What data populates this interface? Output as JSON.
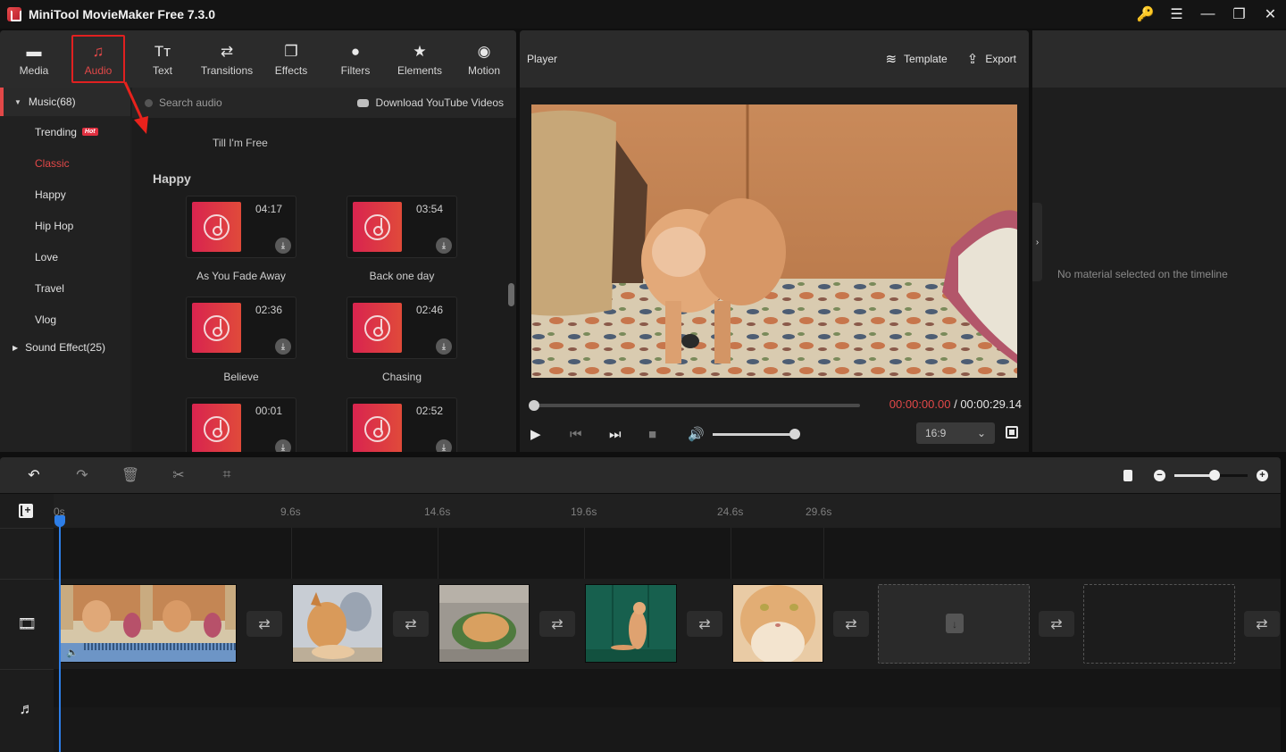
{
  "window": {
    "title": "MiniTool MovieMaker Free 7.3.0",
    "controls": [
      {
        "name": "key-icon",
        "glyph": "🔑"
      },
      {
        "name": "menu-icon",
        "glyph": "☰"
      },
      {
        "name": "minimize-icon",
        "glyph": "—"
      },
      {
        "name": "maximize-icon",
        "glyph": "❐"
      },
      {
        "name": "close-icon",
        "glyph": "✕"
      }
    ]
  },
  "toolbar": {
    "tabs": [
      {
        "label": "Media",
        "icon": "folder-icon",
        "glyph": "▬"
      },
      {
        "label": "Audio",
        "icon": "music-icon",
        "glyph": "♫",
        "active": true
      },
      {
        "label": "Text",
        "icon": "text-icon",
        "glyph": "Tт"
      },
      {
        "label": "Transitions",
        "icon": "transitions-icon",
        "glyph": "⇄"
      },
      {
        "label": "Effects",
        "icon": "effects-icon",
        "glyph": "❐"
      },
      {
        "label": "Filters",
        "icon": "filters-icon",
        "glyph": "●"
      },
      {
        "label": "Elements",
        "icon": "elements-icon",
        "glyph": "★"
      },
      {
        "label": "Motion",
        "icon": "motion-icon",
        "glyph": "◉"
      }
    ]
  },
  "audio_library": {
    "music_group": "Music(68)",
    "categories": [
      {
        "label": "Trending",
        "badge": "Hot"
      },
      {
        "label": "Classic",
        "active": true
      },
      {
        "label": "Happy"
      },
      {
        "label": "Hip Hop"
      },
      {
        "label": "Love"
      },
      {
        "label": "Travel"
      },
      {
        "label": "Vlog"
      }
    ],
    "sound_effect_group": "Sound Effect(25)",
    "search_placeholder": "Search audio",
    "download_youtube": "Download YouTube Videos",
    "previous_item_title": "Till I'm Free",
    "section_title": "Happy",
    "tracks": [
      {
        "title": "As You Fade Away",
        "duration": "04:17"
      },
      {
        "title": "Back one day",
        "duration": "03:54"
      },
      {
        "title": "Believe",
        "duration": "02:36"
      },
      {
        "title": "Chasing",
        "duration": "02:46"
      },
      {
        "title": "",
        "duration": "00:01"
      },
      {
        "title": "",
        "duration": "02:52"
      }
    ]
  },
  "player": {
    "title": "Player",
    "template_label": "Template",
    "export_label": "Export",
    "current_time": "00:00:00.00",
    "separator": " / ",
    "total_time": "00:00:29.14",
    "progress_percent": 0,
    "volume_percent": 100,
    "aspect_ratio": "16:9",
    "controls": {
      "play": "▶",
      "prev_frame": "⏮",
      "next_frame": "⏭",
      "stop": "■",
      "volume": "🔊"
    }
  },
  "properties": {
    "empty_message": "No material selected on the timeline",
    "collapse_glyph": "›"
  },
  "timeline": {
    "tools": [
      {
        "name": "undo",
        "glyph": "↶",
        "enabled": true
      },
      {
        "name": "redo",
        "glyph": "↷",
        "enabled": false
      },
      {
        "name": "delete",
        "glyph": "🗑",
        "enabled": false
      },
      {
        "name": "split",
        "glyph": "✂",
        "enabled": false
      },
      {
        "name": "crop",
        "glyph": "⌗",
        "enabled": false
      }
    ],
    "zoom_percent": 55,
    "ruler_ticks": [
      "0s",
      "9.6s",
      "14.6s",
      "19.6s",
      "24.6s",
      "29.6s"
    ],
    "track_icons": {
      "video": "🎞",
      "music": "♬"
    },
    "clips": [
      {
        "type": "video",
        "subject": "kitten on couch",
        "has_audio": true
      },
      {
        "type": "image",
        "subject": "kitten lying"
      },
      {
        "type": "image",
        "subject": "cat in basket"
      },
      {
        "type": "image",
        "subject": "cat by green door"
      },
      {
        "type": "image",
        "subject": "long-haired cat face"
      }
    ],
    "transition_glyph": "⇄",
    "empty_slots": 2
  }
}
